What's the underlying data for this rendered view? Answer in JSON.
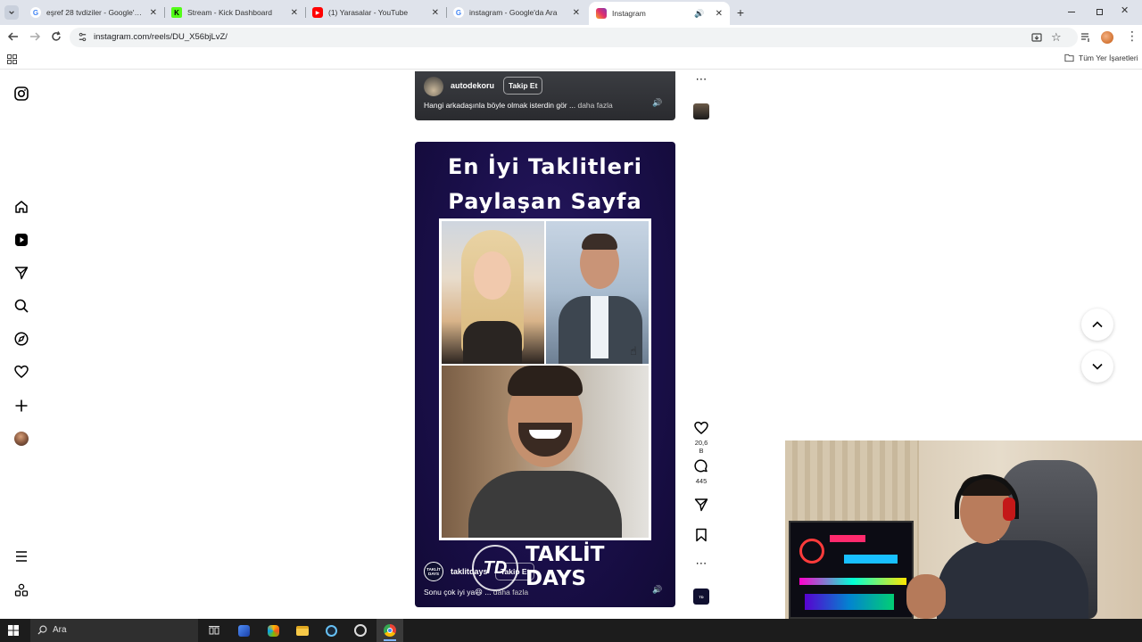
{
  "browser": {
    "tabs": [
      {
        "title": "eşref 28 tvdiziler - Google'da Ara",
        "favicon": "google-icon",
        "active": false
      },
      {
        "title": "Stream - Kick Dashboard",
        "favicon": "kick-icon",
        "active": false
      },
      {
        "title": "(1) Yarasalar - YouTube",
        "favicon": "youtube-icon",
        "active": false
      },
      {
        "title": "instagram - Google'da Ara",
        "favicon": "google-icon",
        "active": false
      },
      {
        "title": "Instagram",
        "favicon": "instagram-icon",
        "active": true
      }
    ],
    "url": "instagram.com/reels/DU_X56bjLvZ/",
    "bookmarks_label": "Tüm Yer İşaretleri"
  },
  "reels": {
    "previous": {
      "username": "autodekoru",
      "follow_label": "Takip Et",
      "caption": "Hangi arkadaşınla böyle olmak isterdin gör ...",
      "more_label": "daha fazla"
    },
    "current": {
      "headline_line1": "En İyi Taklitleri",
      "headline_line2": "Paylaşan Sayfa",
      "watermark_line1": "TAKLİT",
      "watermark_line2": "DAYS",
      "username": "taklitdays",
      "follow_label": "Takip Et",
      "caption": "Sonu çok iyi ya😆 ...",
      "more_label": "daha fazla",
      "likes": "20,6 B",
      "comments": "445",
      "avatar_text": "TAKLİT DAYS"
    }
  },
  "taskbar": {
    "search_placeholder": "Ara"
  },
  "colors": {
    "reel_bg": "#1a0f4a",
    "tab_strip": "#dfe3eb",
    "taskbar": "#1c1c1c",
    "accent_instagram": "#e1306c"
  }
}
